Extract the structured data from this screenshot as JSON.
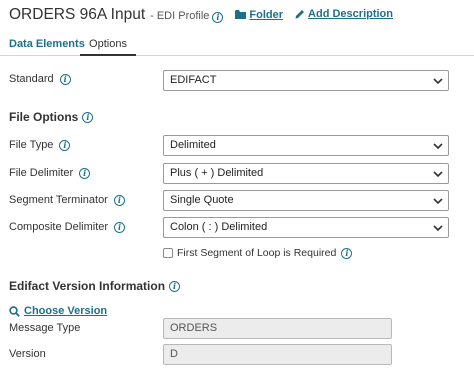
{
  "header": {
    "title": "ORDERS 96A Input",
    "subtitle": "- EDI Profile",
    "folder_label": "Folder",
    "add_description_label": "Add Description"
  },
  "tabs": [
    {
      "label": "Data Elements",
      "active": false
    },
    {
      "label": "Options",
      "active": true
    }
  ],
  "info_glyph": "i",
  "standard": {
    "label": "Standard",
    "value": "EDIFACT"
  },
  "file_options": {
    "heading": "File Options",
    "file_type": {
      "label": "File Type",
      "value": "Delimited"
    },
    "file_delimiter": {
      "label": "File Delimiter",
      "value": "Plus ( + ) Delimited"
    },
    "segment_terminator": {
      "label": "Segment Terminator",
      "value": "Single Quote"
    },
    "composite_delimiter": {
      "label": "Composite Delimiter",
      "value": "Colon ( : ) Delimited"
    },
    "first_segment_checkbox": {
      "label": "First Segment of Loop is Required",
      "checked": false
    }
  },
  "version_info": {
    "heading": "Edifact Version Information",
    "choose_version_label": "Choose Version",
    "message_type": {
      "label": "Message Type",
      "value": "ORDERS"
    },
    "version": {
      "label": "Version",
      "value": "D"
    }
  },
  "colors": {
    "accent": "#1f6f8b",
    "text": "#333333",
    "readonly_bg": "#ececec"
  },
  "icons": {
    "info": "info-icon",
    "folder": "folder-icon",
    "edit": "pencil-icon",
    "search": "search-icon",
    "dropdown": "chevron-down-icon"
  }
}
